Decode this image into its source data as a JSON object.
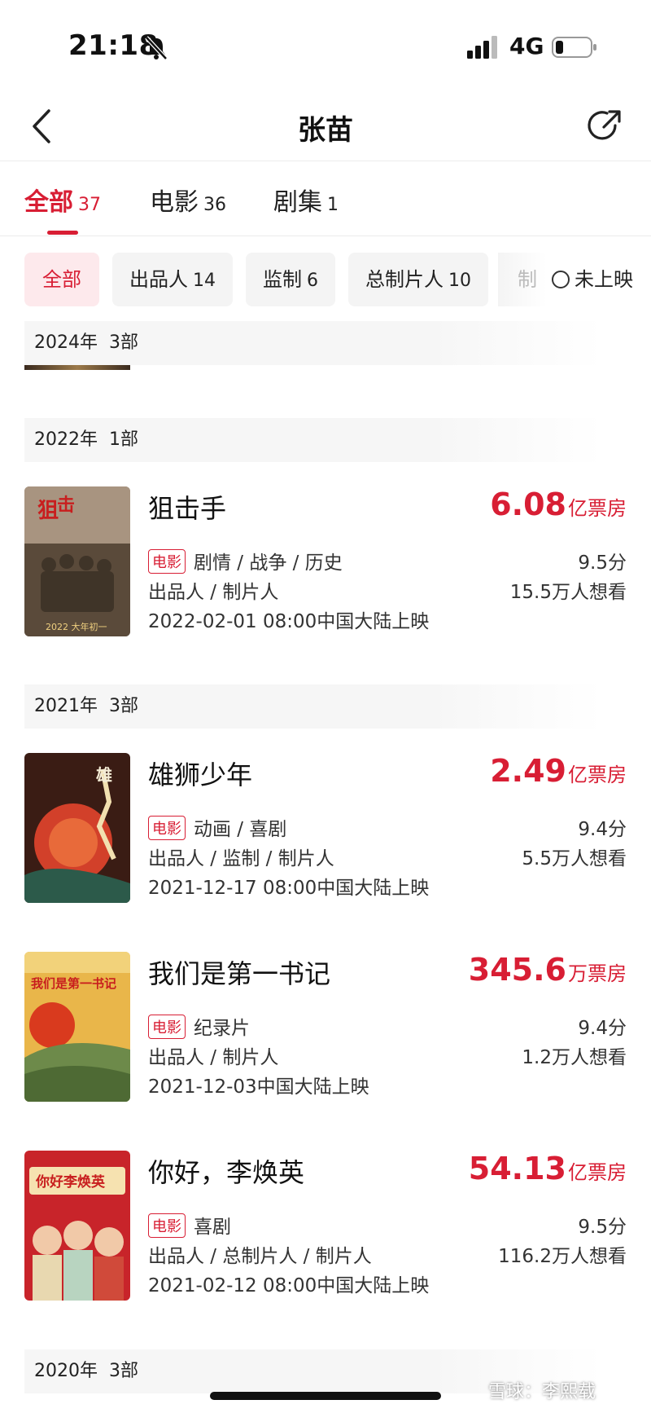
{
  "status_bar": {
    "time": "21:18",
    "network": "4G"
  },
  "nav": {
    "title": "张苗"
  },
  "tabs": [
    {
      "label": "全部",
      "count": "37",
      "active": true
    },
    {
      "label": "电影",
      "count": "36",
      "active": false
    },
    {
      "label": "剧集",
      "count": "1",
      "active": false
    }
  ],
  "chips": [
    {
      "label": "全部",
      "count": "",
      "active": true
    },
    {
      "label": "出品人",
      "count": "14",
      "active": false
    },
    {
      "label": "监制",
      "count": "6",
      "active": false
    },
    {
      "label": "总制片人",
      "count": "10",
      "active": false
    },
    {
      "label": "制",
      "count": "",
      "active": false
    }
  ],
  "unreleased_toggle": {
    "label": "未上映"
  },
  "year_groups": [
    {
      "year": "2024年",
      "count": "3部"
    },
    {
      "year": "2022年",
      "count": "1部"
    },
    {
      "year": "2021年",
      "count": "3部"
    },
    {
      "year": "2020年",
      "count": "3部"
    }
  ],
  "movies": [
    {
      "title": "狙击手",
      "box_value": "6.08",
      "box_unit": "亿票房",
      "type_badge": "电影",
      "genres": "剧情 / 战争 / 历史",
      "roles": "出品人 / 制片人",
      "release": "2022-02-01 08:00中国大陆上映",
      "score": "9.5分",
      "want": "15.5万人想看",
      "poster_text": "2022 大年初一"
    },
    {
      "title": "雄狮少年",
      "box_value": "2.49",
      "box_unit": "亿票房",
      "type_badge": "电影",
      "genres": "动画 / 喜剧",
      "roles": "出品人 / 监制 / 制片人",
      "release": "2021-12-17 08:00中国大陆上映",
      "score": "9.4分",
      "want": "5.5万人想看",
      "poster_text": "雄狮少年"
    },
    {
      "title": "我们是第一书记",
      "box_value": "345.6",
      "box_unit": "万票房",
      "type_badge": "电影",
      "genres": "纪录片",
      "roles": "出品人 / 制片人",
      "release": "2021-12-03中国大陆上映",
      "score": "9.4分",
      "want": "1.2万人想看",
      "poster_text": "我们是第一书记"
    },
    {
      "title": "你好，李焕英",
      "box_value": "54.13",
      "box_unit": "亿票房",
      "type_badge": "电影",
      "genres": "喜剧",
      "roles": "出品人 / 总制片人 / 制片人",
      "release": "2021-02-12 08:00中国大陆上映",
      "score": "9.5分",
      "want": "116.2万人想看",
      "poster_text": "你好李焕英"
    }
  ],
  "watermark": "雪球：李熙载",
  "colors": {
    "accent": "#d81e34",
    "chip_active_bg": "#fde9ec",
    "chip_bg": "#f4f4f4"
  }
}
